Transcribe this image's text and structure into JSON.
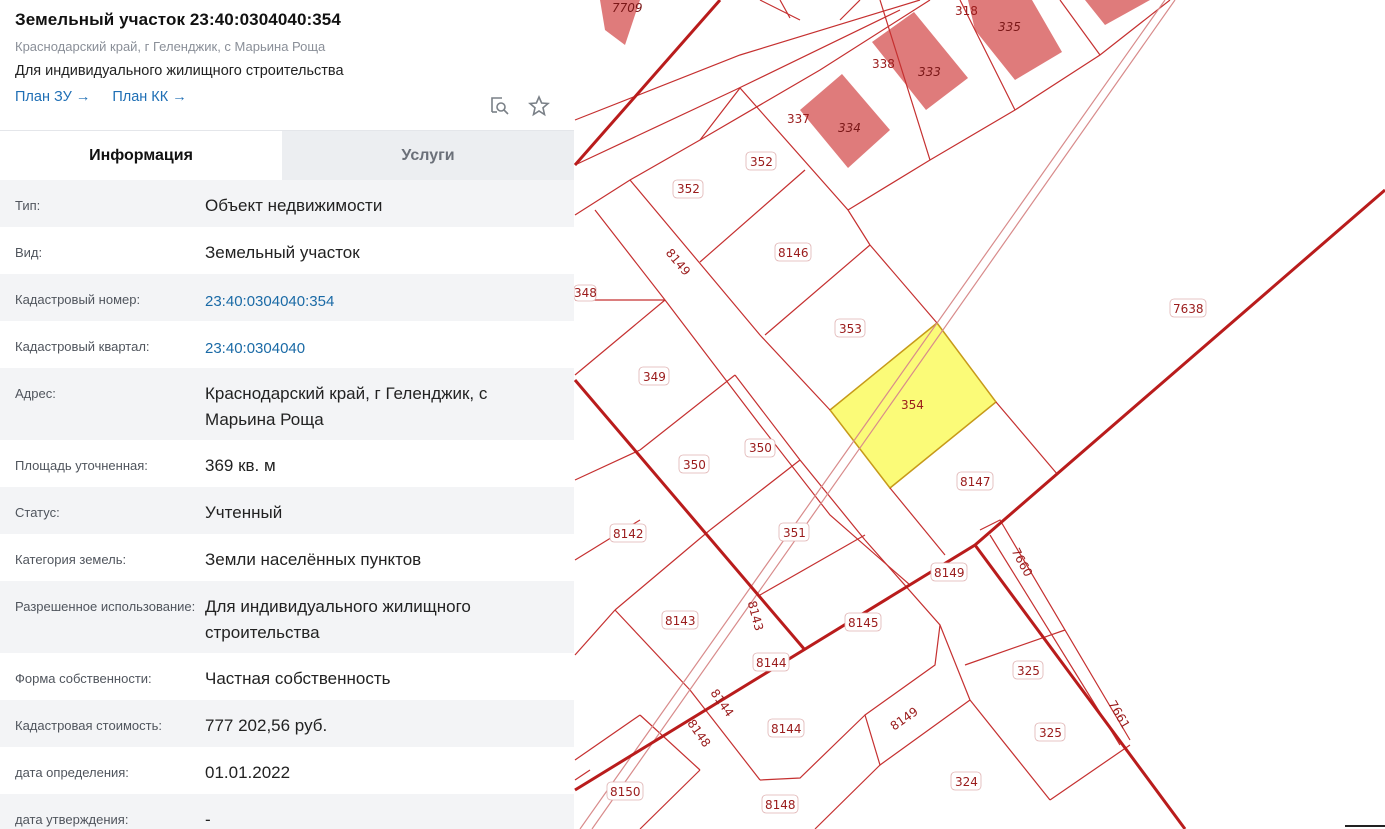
{
  "parcel": {
    "title": "Земельный участок 23:40:0304040:354",
    "address_short": "Краснодарский край, г Геленджик, с Марьина Роща",
    "purpose": "Для индивидуального жилищного строительства",
    "links": [
      {
        "label": "План ЗУ →"
      },
      {
        "label": "План КК →"
      }
    ],
    "icons": [
      "search-map-icon",
      "star-icon"
    ]
  },
  "tabs": [
    {
      "label": "Информация",
      "active": true
    },
    {
      "label": "Услуги",
      "active": false
    }
  ],
  "rows": [
    {
      "label": "Тип:",
      "value": "Объект недвижимости"
    },
    {
      "label": "Вид:",
      "value": "Земельный участок"
    },
    {
      "label": "Кадастровый номер:",
      "value": "23:40:0304040:354"
    },
    {
      "label": "Кадастровый квартал:",
      "value": "23:40:0304040"
    },
    {
      "label": "Адрес:",
      "value": "Краснодарский край, г Геленджик, с Марьина Роща"
    },
    {
      "label": "Площадь уточненная:",
      "value": "369 кв. м"
    },
    {
      "label": "Статус:",
      "value": "Учтенный"
    },
    {
      "label": "Категория земель:",
      "value": "Земли населённых пунктов"
    },
    {
      "label": "Разрешенное использование:",
      "value": "Для индивидуального жилищного строительства"
    },
    {
      "label": "Форма собственности:",
      "value": "Частная собственность"
    },
    {
      "label": "Кадастровая стоимость:",
      "value": "777 202,56 руб."
    },
    {
      "label": "дата определения:",
      "value": "01.01.2022"
    },
    {
      "label": "дата утверждения:",
      "value": "-"
    }
  ],
  "map": {
    "selected_parcel": "354",
    "highlight_color": "#fbfb78",
    "boundary_color": "#b91c1c",
    "building_color": "#df7b7b",
    "parcel_labels": [
      "7709",
      "318",
      "335",
      "338",
      "333",
      "337",
      "334",
      "352",
      "352",
      "8146",
      "8149",
      "348",
      "353",
      "354",
      "7638",
      "349",
      "350",
      "350",
      "8147",
      "351",
      "8142",
      "8149",
      "7660",
      "8143",
      "8143",
      "8145",
      "8144",
      "325",
      "8144",
      "8149",
      "325",
      "8148",
      "8144",
      "7661",
      "324",
      "8150",
      "8148"
    ]
  }
}
